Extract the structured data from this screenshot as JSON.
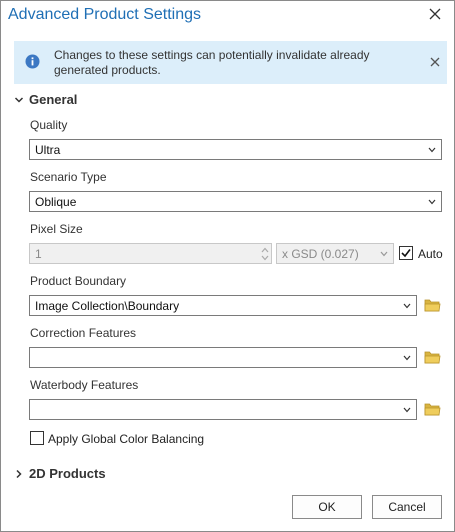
{
  "dialog": {
    "title": "Advanced Product Settings",
    "close_icon": "close-icon"
  },
  "info_bar": {
    "icon": "info-icon",
    "message": "Changes to these settings can potentially invalidate already generated products.",
    "close_icon": "close-icon"
  },
  "general": {
    "header": "General",
    "expanded": true,
    "quality": {
      "label": "Quality",
      "value": "Ultra"
    },
    "scenario_type": {
      "label": "Scenario Type",
      "value": "Oblique"
    },
    "pixel_size": {
      "label": "Pixel Size",
      "value": "1",
      "unit": "x GSD (0.027)",
      "auto_label": "Auto",
      "auto_checked": true
    },
    "product_boundary": {
      "label": "Product Boundary",
      "value": "Image Collection\\Boundary"
    },
    "correction_features": {
      "label": "Correction Features",
      "value": ""
    },
    "waterbody_features": {
      "label": "Waterbody Features",
      "value": ""
    },
    "color_balancing": {
      "label": "Apply Global Color Balancing",
      "checked": false
    }
  },
  "products_2d": {
    "header": "2D Products",
    "expanded": false
  },
  "buttons": {
    "ok": "OK",
    "cancel": "Cancel"
  },
  "colors": {
    "title": "#1f6fb5",
    "info_bg": "#dceefa",
    "folder": "#d9b441"
  }
}
